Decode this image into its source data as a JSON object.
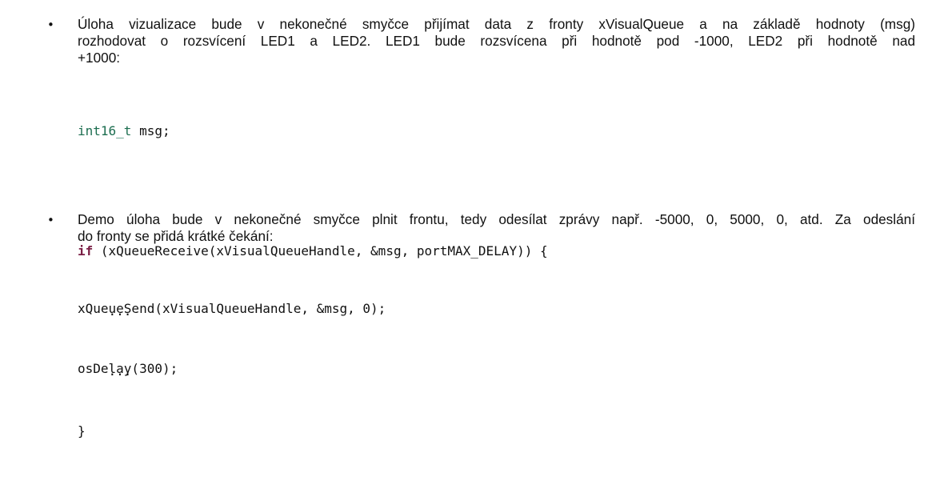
{
  "items": [
    {
      "bullet": "•",
      "text_line1": "Úloha vizualizace bude v nekonečné smyčce přijímat data z fronty xVisualQueue a na základě hodnoty (msg)",
      "text_line2": "rozhodovat o rozsvícení LED1 a LED2. LED1 bude rozsvícena při hodnotě pod -1000, LED2 při hodnotě nad",
      "text_line3": "+1000:"
    },
    {
      "bullet": "•",
      "text_line1": "Demo úloha bude v nekonečné smyčce plnit frontu, tedy odesílat zprávy např. -5000, 0, 5000, 0, atd. Za odeslání",
      "text_line2": "do fronty se přidá krátké čekání:"
    }
  ],
  "code1": {
    "decl_type": "int16_t",
    "decl_rest": " msg;",
    "if_kw": "if",
    "if_rest": " (xQueueReceive(xVisualQueueHandle, &msg, portMAX_DELAY)) {",
    "dots1": "    ...",
    "dots2": "    ...",
    "close": "}"
  },
  "code2": {
    "line1": "xQueueSend(xVisualQueueHandle, &msg, 0);",
    "line2": "osDelay(300);"
  }
}
